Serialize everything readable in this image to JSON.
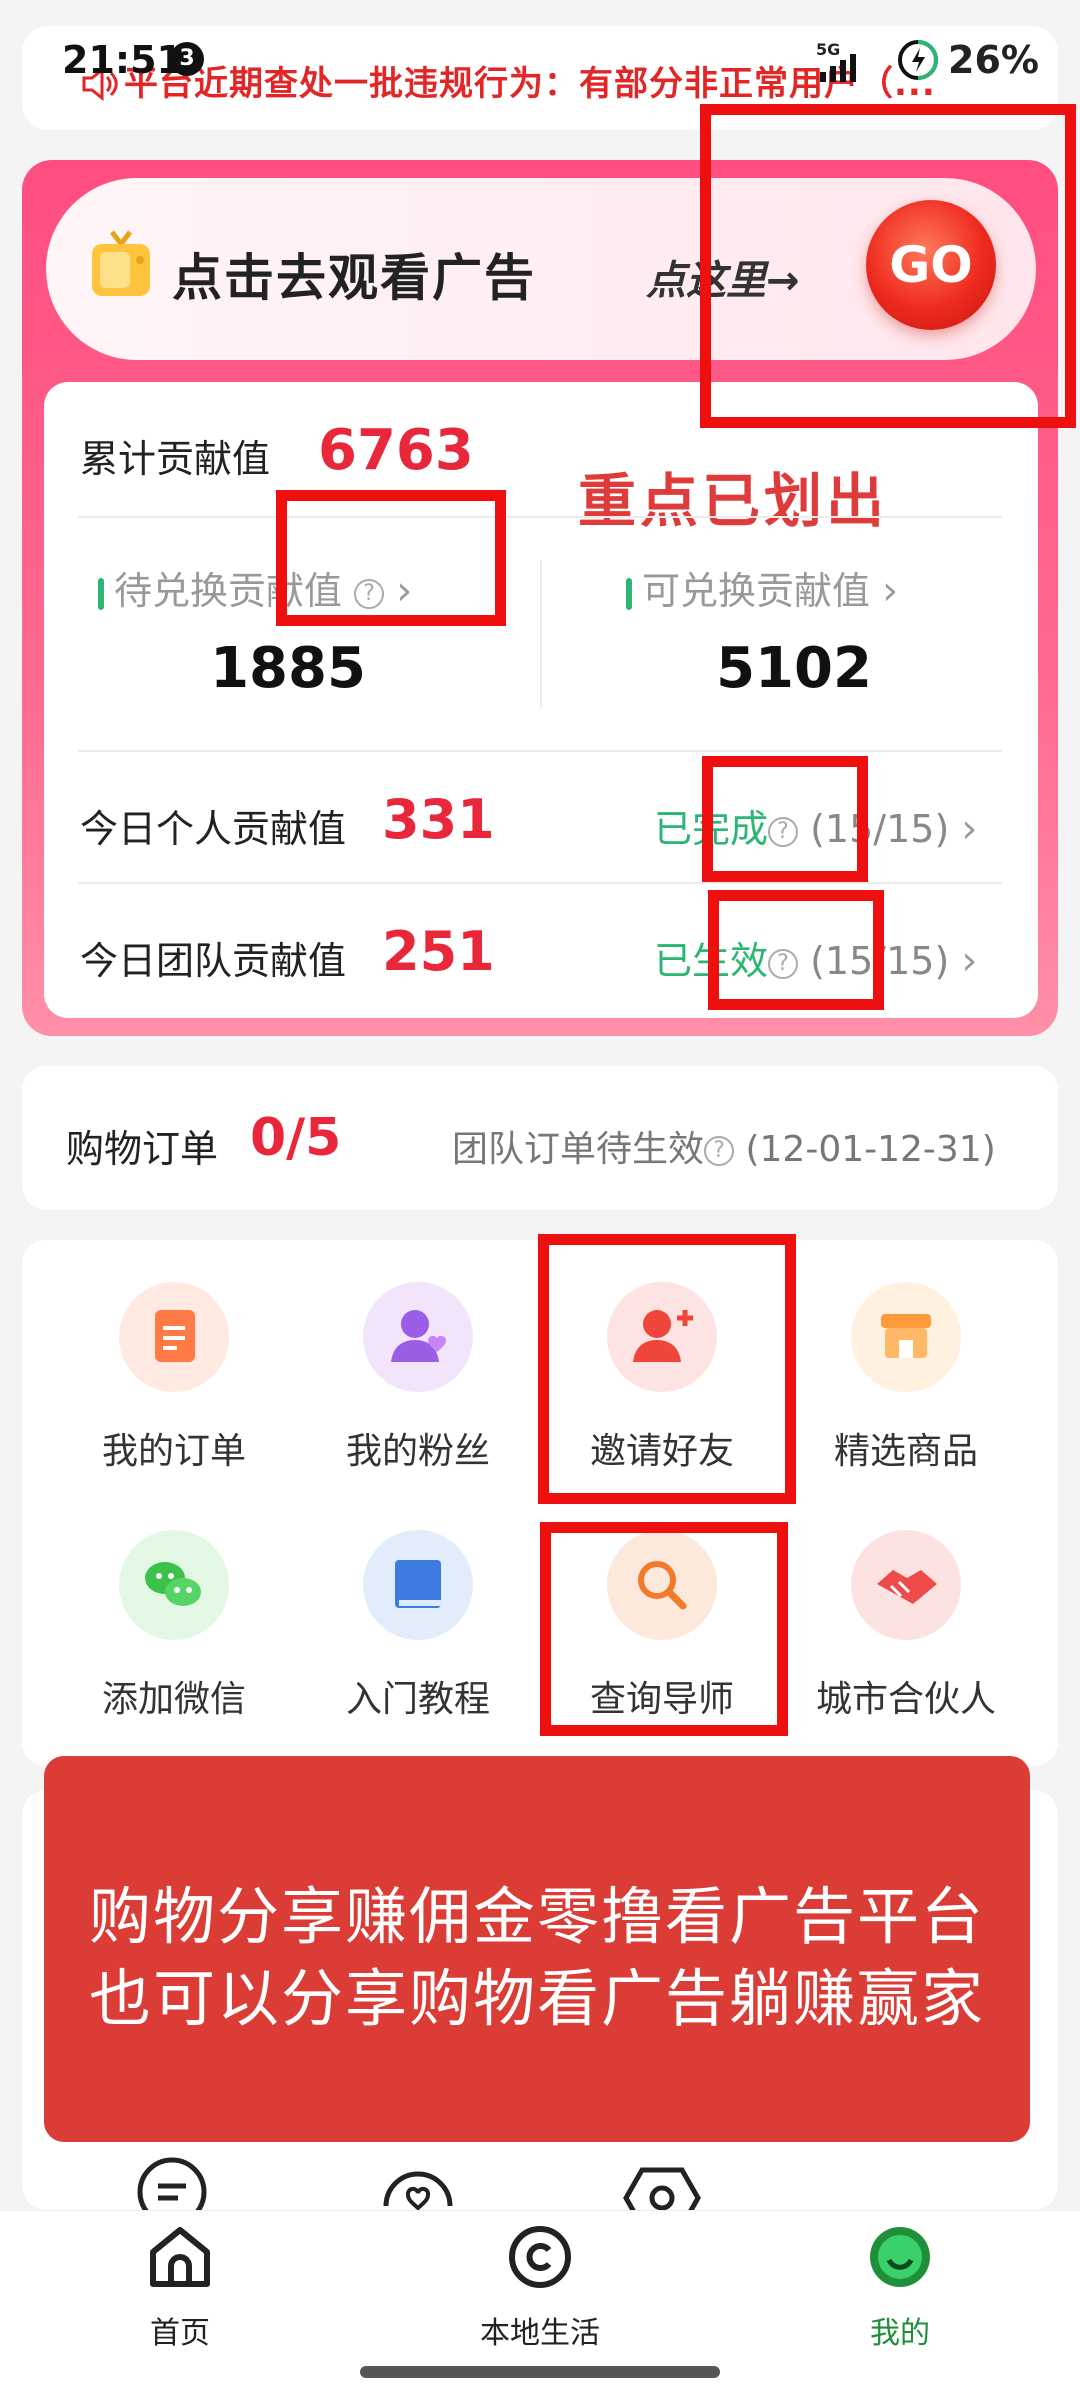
{
  "status": {
    "time": "21:51",
    "badge": "3",
    "net": "5G",
    "battery": "26%"
  },
  "notice": {
    "text": "平台近期查处一批违规行为：有部分非正常用户（..."
  },
  "ad": {
    "title": "点击去观看广告",
    "hint": "点这里→",
    "go": "GO"
  },
  "summary": {
    "total_label": "累计贡献值",
    "total_value": "6763",
    "annotation": "重点已划出",
    "pending_label": "待兑换贡献值",
    "pending_value": "1885",
    "available_label": "可兑换贡献值",
    "available_value": "5102",
    "today_personal_label": "今日个人贡献值",
    "today_personal_value": "331",
    "today_personal_status": "已完成",
    "today_personal_progress": "(15/15)",
    "today_team_label": "今日团队贡献值",
    "today_team_value": "251",
    "today_team_status": "已生效",
    "today_team_progress": "(15/15)"
  },
  "orders": {
    "label": "购物订单",
    "value": "0/5",
    "team_status": "团队订单待生效",
    "date_range": "(12-01-12-31)"
  },
  "menu": [
    {
      "label": "我的订单",
      "icon": "order-icon",
      "color": "#ff7a45"
    },
    {
      "label": "我的粉丝",
      "icon": "fans-icon",
      "color": "#9b5de5"
    },
    {
      "label": "邀请好友",
      "icon": "invite-friend-icon",
      "color": "#f0453a"
    },
    {
      "label": "精选商品",
      "icon": "store-icon",
      "color": "#ff9a3c"
    },
    {
      "label": "添加微信",
      "icon": "wechat-icon",
      "color": "#3bc24a"
    },
    {
      "label": "入门教程",
      "icon": "book-icon",
      "color": "#3e7be0"
    },
    {
      "label": "查询导师",
      "icon": "search-mentor-icon",
      "color": "#f27a2c"
    },
    {
      "label": "城市合伙人",
      "icon": "handshake-icon",
      "color": "#ef4b4b"
    }
  ],
  "banner": {
    "line1": "购物分享赚佣金零撸看广告平台",
    "line2": "也可以分享购物看广告躺赚赢家"
  },
  "tabs": [
    {
      "label": "首页",
      "icon": "home-icon"
    },
    {
      "label": "本地生活",
      "icon": "local-life-icon"
    },
    {
      "label": "我的",
      "icon": "profile-icon"
    }
  ],
  "colors": {
    "accent_red": "#e8283a",
    "green": "#2bb673",
    "annotation_red": "#ee0f0f",
    "tab_active": "#1f8f3a"
  }
}
